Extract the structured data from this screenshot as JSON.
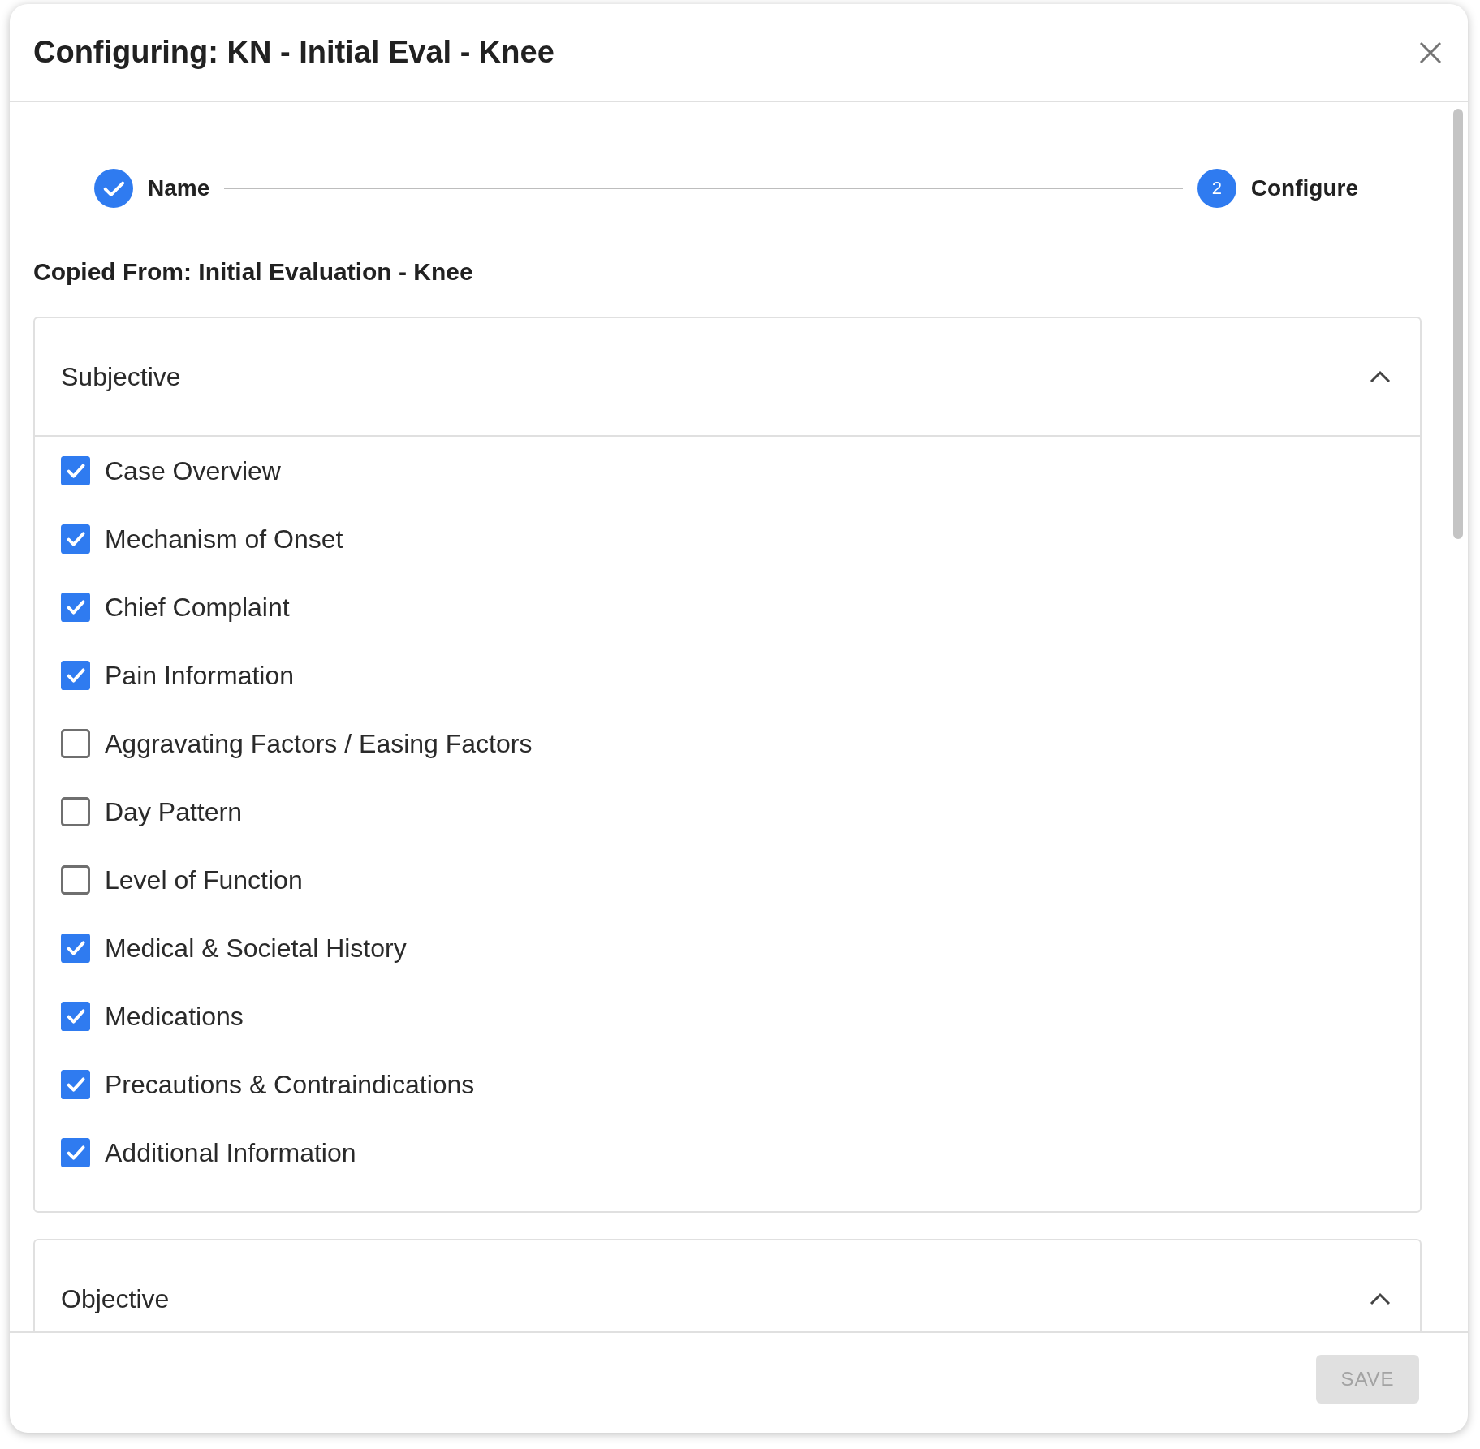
{
  "dialog": {
    "title": "Configuring: KN - Initial Eval - Knee"
  },
  "stepper": [
    {
      "label": "Name",
      "completed": true
    },
    {
      "label": "Configure",
      "number": "2",
      "completed": false
    }
  ],
  "copied_from": "Copied From: Initial Evaluation - Knee",
  "sections": [
    {
      "title": "Subjective",
      "expanded": true,
      "items": [
        {
          "label": "Case Overview",
          "checked": true
        },
        {
          "label": "Mechanism of Onset",
          "checked": true
        },
        {
          "label": "Chief Complaint",
          "checked": true
        },
        {
          "label": "Pain Information",
          "checked": true
        },
        {
          "label": "Aggravating Factors / Easing Factors",
          "checked": false
        },
        {
          "label": "Day Pattern",
          "checked": false
        },
        {
          "label": "Level of Function",
          "checked": false
        },
        {
          "label": "Medical & Societal History",
          "checked": true
        },
        {
          "label": "Medications",
          "checked": true
        },
        {
          "label": "Precautions & Contraindications",
          "checked": true
        },
        {
          "label": "Additional Information",
          "checked": true
        }
      ]
    },
    {
      "title": "Objective",
      "expanded": true
    }
  ],
  "footer": {
    "save_button": {
      "label": "SAVE",
      "disabled": true
    }
  }
}
